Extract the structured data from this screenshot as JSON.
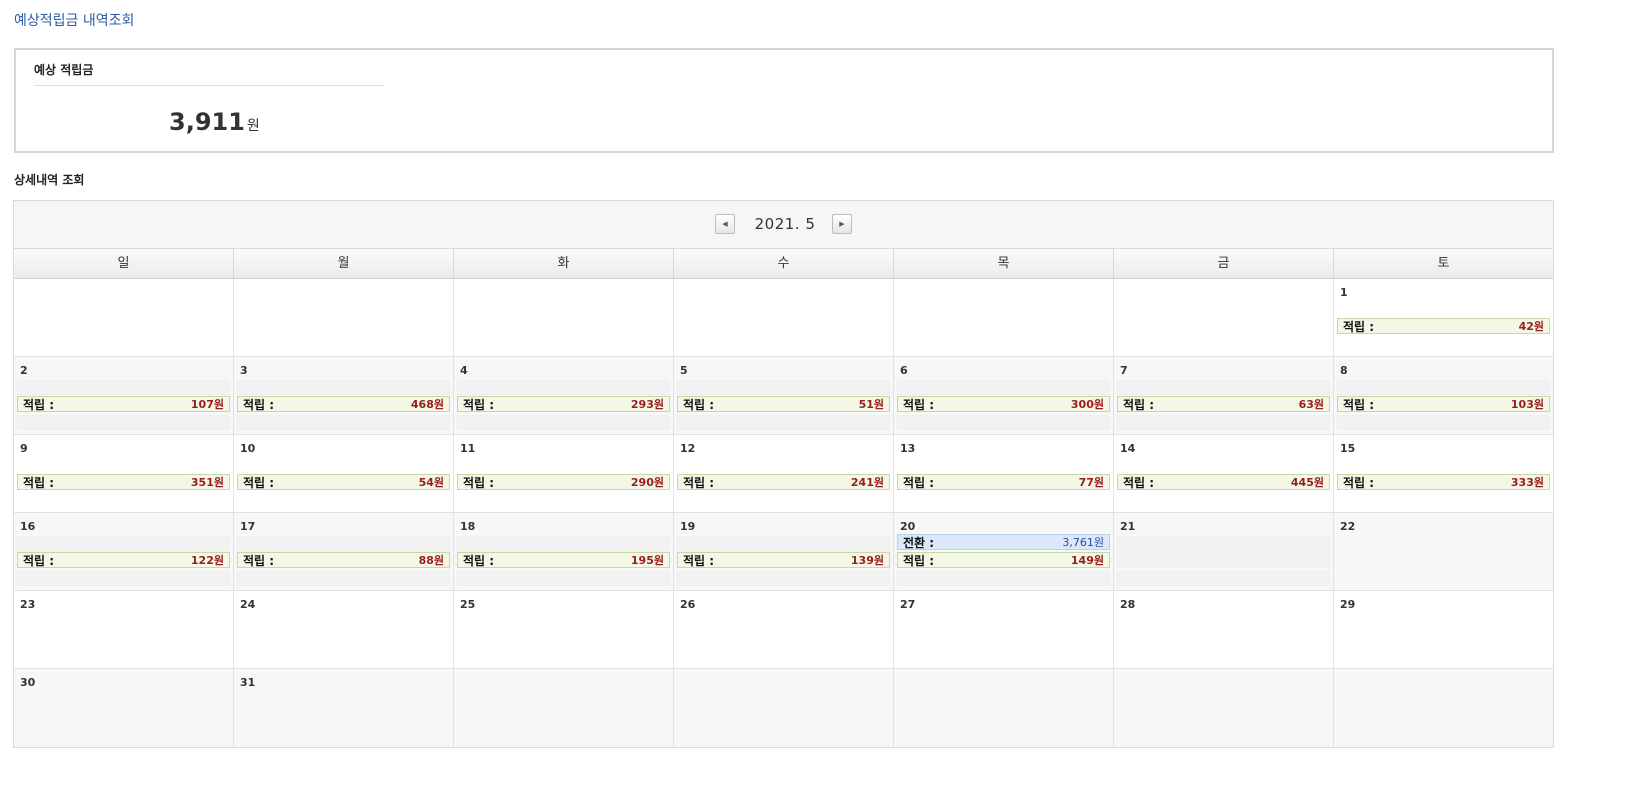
{
  "page_title": "예상적립금 내역조회",
  "summary": {
    "label": "예상 적립금",
    "value": "3,911",
    "unit": "원"
  },
  "section_title": "상세내역 조회",
  "calendar": {
    "month_label": "2021. 5",
    "prev_icon": "◀",
    "next_icon": "▶",
    "weekdays": [
      "일",
      "월",
      "화",
      "수",
      "목",
      "금",
      "토"
    ]
  },
  "entries": {
    "accrual_label": "적립 :",
    "conversion_label": "전환 :",
    "d1": "42원",
    "d2": "107원",
    "d3": "468원",
    "d4": "293원",
    "d5": "51원",
    "d6": "300원",
    "d7": "63원",
    "d8": "103원",
    "d9": "351원",
    "d10": "54원",
    "d11": "290원",
    "d12": "241원",
    "d13": "77원",
    "d14": "445원",
    "d15": "333원",
    "d16": "122원",
    "d17": "88원",
    "d18": "195원",
    "d19": "139원",
    "d20": "149원",
    "d20_conversion": "3,761원"
  },
  "days": [
    "1",
    "2",
    "3",
    "4",
    "5",
    "6",
    "7",
    "8",
    "9",
    "10",
    "11",
    "12",
    "13",
    "14",
    "15",
    "16",
    "17",
    "18",
    "19",
    "20",
    "21",
    "22",
    "23",
    "24",
    "25",
    "26",
    "27",
    "28",
    "29",
    "30",
    "31"
  ],
  "colors": {
    "title_blue": "#2e5aa7",
    "amount_red": "#9b1c1c",
    "accrual_bg": "#f3f7e6",
    "conversion_bg": "#dbe8fb"
  }
}
